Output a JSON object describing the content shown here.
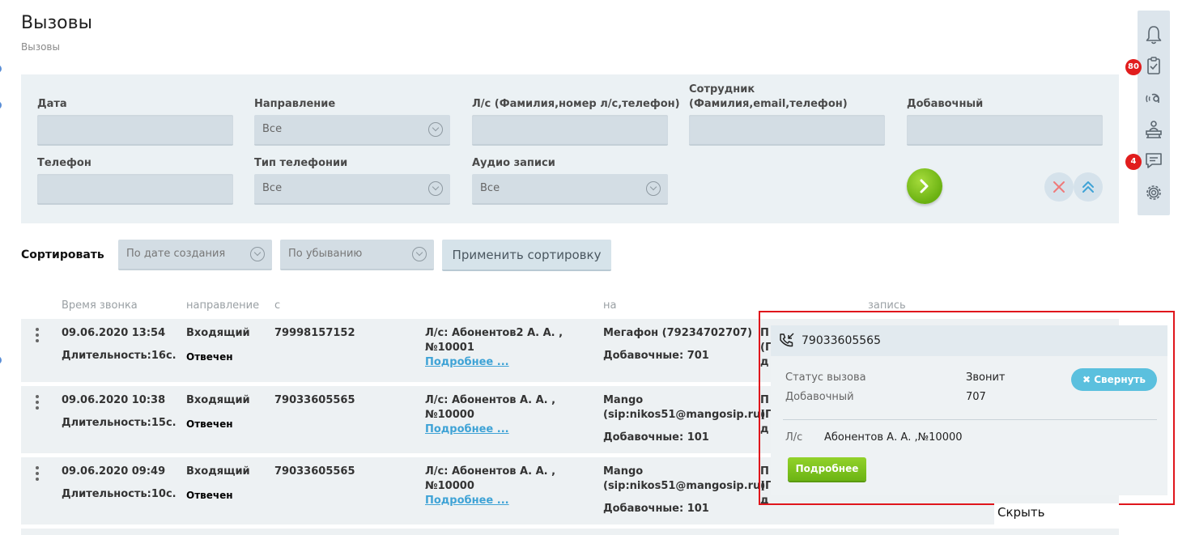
{
  "page": {
    "title": "Вызовы",
    "breadcrumb": "Вызовы"
  },
  "filters": {
    "date_label": "Дата",
    "direction_label": "Направление",
    "direction_value": "Все",
    "account_label": "Л/с (Фамилия,номер л/с,телефон)",
    "employee_label_1": "Сотрудник",
    "employee_label_2": "(Фамилия,email,телефон)",
    "extension_label": "Добавочный",
    "phone_label": "Телефон",
    "telephony_label": "Тип телефонии",
    "telephony_value": "Все",
    "audio_label": "Аудио записи",
    "audio_value": "Все"
  },
  "sort": {
    "label": "Сортировать",
    "field_value": "По дате создания",
    "order_value": "По убыванию",
    "apply_label": "Применить сортировку"
  },
  "table": {
    "headers": [
      "Время звонка",
      "направление",
      "с",
      "на",
      "запись"
    ],
    "rows": [
      {
        "time": "09.06.2020 13:54",
        "duration": "Длительность:16с.",
        "direction": "Входящий",
        "status": "Отвечен",
        "from": "79998157152",
        "account_1": "Л/с: Абонентов2 А. А. ,",
        "account_2": "№10001",
        "more": "Подробнее ...",
        "to_1": "Мегафон (79234702707)",
        "to_2": "",
        "ext": "Добавочные: 701",
        "rec_1": "П",
        "rec_2": "(П",
        "rec_3": "д"
      },
      {
        "time": "09.06.2020 10:38",
        "duration": "Длительность:15с.",
        "direction": "Входящий",
        "status": "Отвечен",
        "from": "79033605565",
        "account_1": "Л/с: Абонентов А. А. ,",
        "account_2": "№10000",
        "more": "Подробнее ...",
        "to_1": "Mango",
        "to_2": "(sip:nikos51@mangosip.ru)",
        "ext": "Добавочные: 101",
        "rec_1": "П",
        "rec_2": "(П",
        "rec_3": "д"
      },
      {
        "time": "09.06.2020 09:49",
        "duration": "Длительность:10с.",
        "direction": "Входящий",
        "status": "Отвечен",
        "from": "79033605565",
        "account_1": "Л/с: Абонентов А. А. ,",
        "account_2": "№10000",
        "more": "Подробнее ...",
        "to_1": "Mango",
        "to_2": "(sip:nikos51@mangosip.ru)",
        "ext": "Добавочные: 101",
        "rec_1": "П",
        "rec_2": "(П",
        "rec_3": "д"
      }
    ]
  },
  "sidebar": {
    "tasks_badge": "80",
    "messages_badge": "4",
    "icons": [
      "bell-icon",
      "tasks-icon",
      "broadcast-icon",
      "reception-icon",
      "chat-icon",
      "settings-icon"
    ]
  },
  "call_popup": {
    "phone": "79033605565",
    "status_label": "Статус вызова",
    "status_value": "Звонит",
    "ext_label": "Добавочный",
    "ext_value": "707",
    "collapse_label": "Свернуть",
    "account_label": "Л/с",
    "account_value": "Абонентов А. А. ,№10000",
    "details_label": "Подробнее",
    "hide_label": "Скрыть"
  },
  "colors": {
    "accent_green": "#6cb414",
    "accent_blue": "#5bc0de",
    "link": "#3fa3d6",
    "badge_red": "#e11d1d",
    "highlight_red": "#e0161c"
  }
}
